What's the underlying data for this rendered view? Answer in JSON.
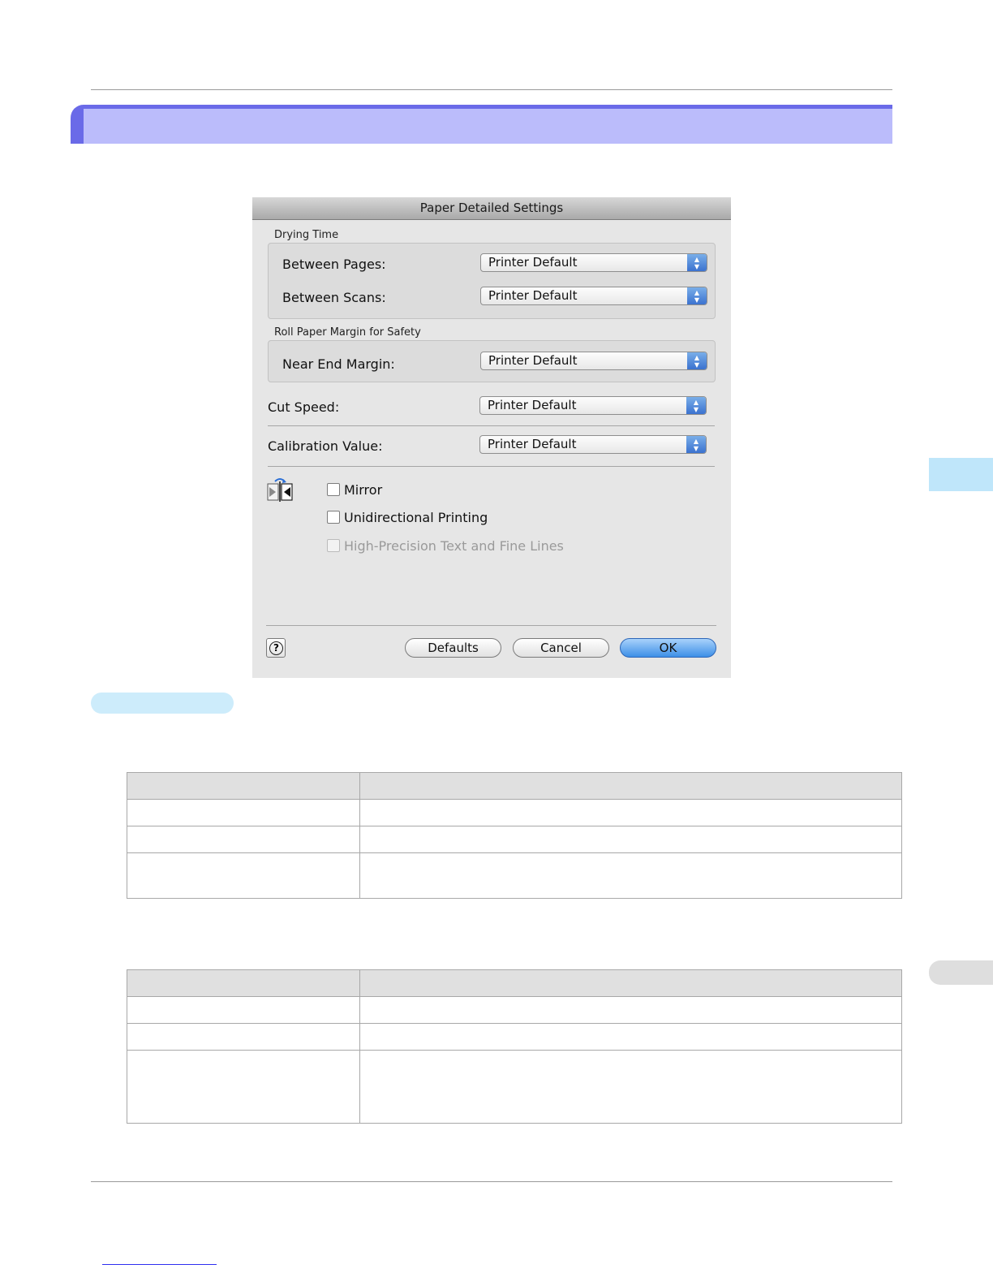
{
  "dialog": {
    "title": "Paper Detailed Settings",
    "drying_time": {
      "group_label": "Drying Time",
      "between_pages": {
        "label": "Between Pages:",
        "value": "Printer Default"
      },
      "between_scans": {
        "label": "Between Scans:",
        "value": "Printer Default"
      }
    },
    "roll_margin": {
      "group_label": "Roll Paper Margin for Safety",
      "near_end_margin": {
        "label": "Near End Margin:",
        "value": "Printer Default"
      }
    },
    "cut_speed": {
      "label": "Cut Speed:",
      "value": "Printer Default"
    },
    "calibration_value": {
      "label": "Calibration Value:",
      "value": "Printer Default"
    },
    "checkboxes": {
      "mirror": {
        "label": "Mirror",
        "checked": false,
        "enabled": true
      },
      "unidirectional": {
        "label": "Unidirectional Printing",
        "checked": false,
        "enabled": true
      },
      "high_precision": {
        "label": "High-Precision Text and Fine Lines",
        "checked": false,
        "enabled": false
      }
    },
    "buttons": {
      "help": "?",
      "defaults": "Defaults",
      "cancel": "Cancel",
      "ok": "OK"
    },
    "icons": {
      "help": "help-icon",
      "mirror": "mirror-icon",
      "popup_stepper": "updown-arrows-icon"
    }
  },
  "colors": {
    "section_bar": "#bbbcfb",
    "section_bar_accent": "#6a6ae8",
    "side_tab": "#bfe6fa",
    "subheading_pill": "#cdecfb",
    "primary_button": "#3d8fe7"
  }
}
